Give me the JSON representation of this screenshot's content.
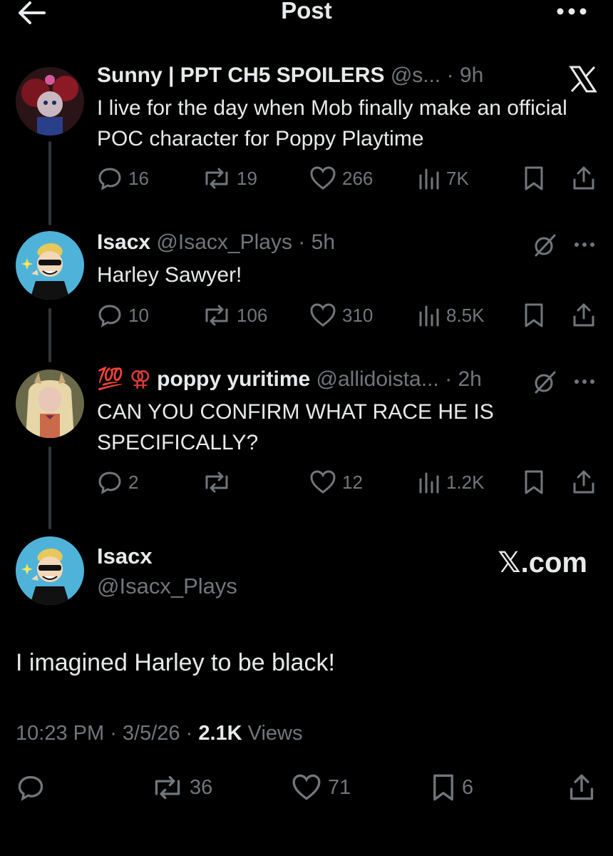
{
  "header": {
    "title": "Post"
  },
  "thread": [
    {
      "name": "Sunny | PPT CH5 SPOILERS",
      "handle": "@s...",
      "time": "9h",
      "text": "I live for the day when Mob finally make an official POC character for Poppy Playtime",
      "replies": "16",
      "reposts": "19",
      "likes": "266",
      "views": "7K",
      "avatar_icon": "poppy-doll-avatar"
    },
    {
      "name": "Isacx",
      "handle": "@Isacx_Plays",
      "time": "5h",
      "text": "Harley Sawyer!",
      "replies": "10",
      "reposts": "106",
      "likes": "310",
      "views": "8.5K",
      "avatar_icon": "sunglasses-character-avatar"
    },
    {
      "prefix": "💯 ⚢",
      "name": "poppy yuritime",
      "handle": "@allidoista...",
      "time": "2h",
      "text": "CAN YOU CONFIRM WHAT RACE HE IS SPECIFICALLY?",
      "replies": "2",
      "reposts": "",
      "likes": "12",
      "views": "1.2K",
      "avatar_icon": "blonde-character-avatar"
    }
  ],
  "main_post": {
    "name": "Isacx",
    "handle": "@Isacx_Plays",
    "watermark": "𝕏.com",
    "text": "I imagined Harley to be black!",
    "time": "10:23 PM",
    "date": "3/5/26",
    "views_count": "2.1K",
    "views_label": "Views",
    "reposts": "36",
    "likes": "71",
    "bookmarks": "6"
  },
  "colors": {
    "background": "#000000",
    "text": "#e7e9ea",
    "muted": "#71767b",
    "thread_line": "#333639",
    "avatar_blue": "#4fb3d9"
  }
}
